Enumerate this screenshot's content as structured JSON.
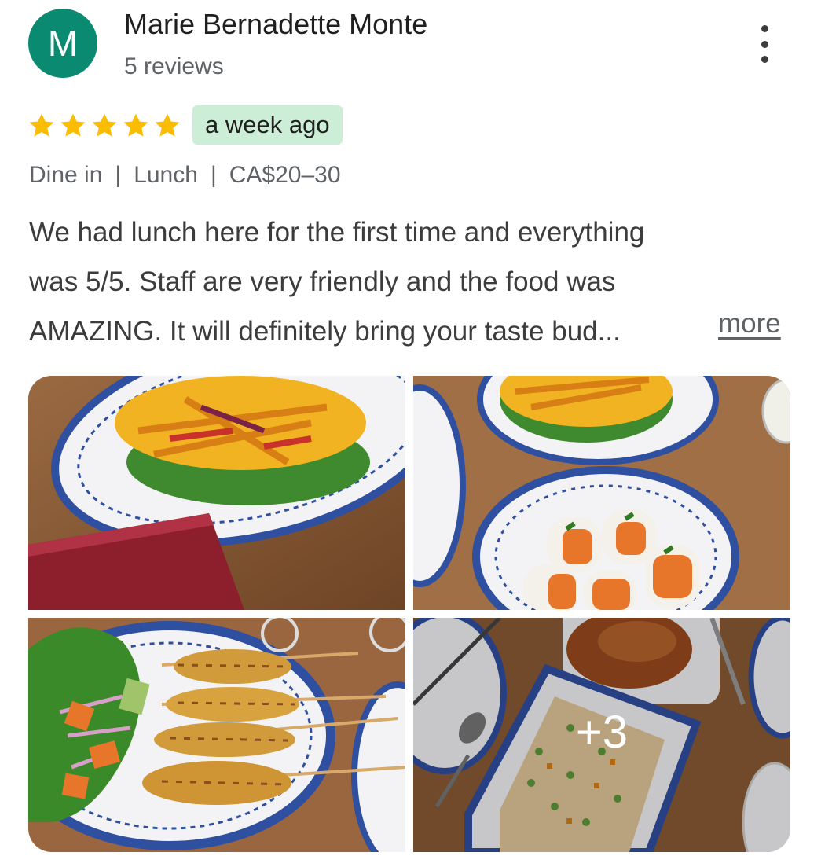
{
  "reviewer": {
    "initial": "M",
    "name": "Marie Bernadette Monte",
    "review_count": "5 reviews",
    "avatar_color": "#0b8a72"
  },
  "review": {
    "rating": 5,
    "rating_max": 5,
    "star_color": "#fbbc04",
    "time_ago": "a week ago",
    "meta": {
      "service": "Dine in",
      "meal": "Lunch",
      "price": "CA$20–30"
    },
    "text_lines": [
      "We had lunch here for the first time and everything",
      "was 5/5. Staff are very friendly and the food was",
      "AMAZING. It will definitely bring your taste bud..."
    ],
    "more_label": "more"
  },
  "photos": {
    "items": [
      {
        "subject": "mango salad on blue-patterned plate"
      },
      {
        "subject": "fresh spring rolls in blue-patterned bowl"
      },
      {
        "subject": "chicken satay skewers with salad"
      },
      {
        "subject": "fried rice and curry dishes"
      }
    ],
    "extra_count_label": "+3"
  },
  "icons": {
    "overflow": "more-vert-icon",
    "star": "star-icon"
  }
}
